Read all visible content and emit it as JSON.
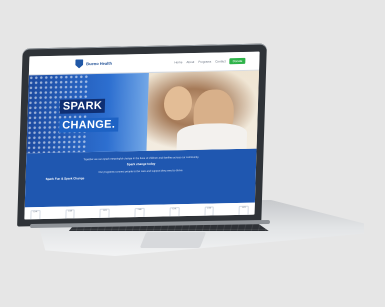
{
  "site": {
    "logo_text": "Bueno Health",
    "nav": [
      "Home",
      "About",
      "Programs",
      "Contact"
    ],
    "cta": "Donate"
  },
  "hero": {
    "line1": "SPARK",
    "line2": "CHANGE."
  },
  "content": {
    "para1": "Together we can spark meaningful change in the lives of children and families across our community.",
    "subhead": "Spark change today",
    "para2": "Our programs connect people to the care and support they need to thrive.",
    "link": "Spark Fun & Spark Change"
  },
  "footer": {
    "links": [
      "Link",
      "Link",
      "Link",
      "Link",
      "Link",
      "Link",
      "Link"
    ]
  },
  "colors": {
    "brand_blue": "#1f57b0",
    "cta_green": "#2fb34a",
    "background": "#e6e6e6"
  }
}
